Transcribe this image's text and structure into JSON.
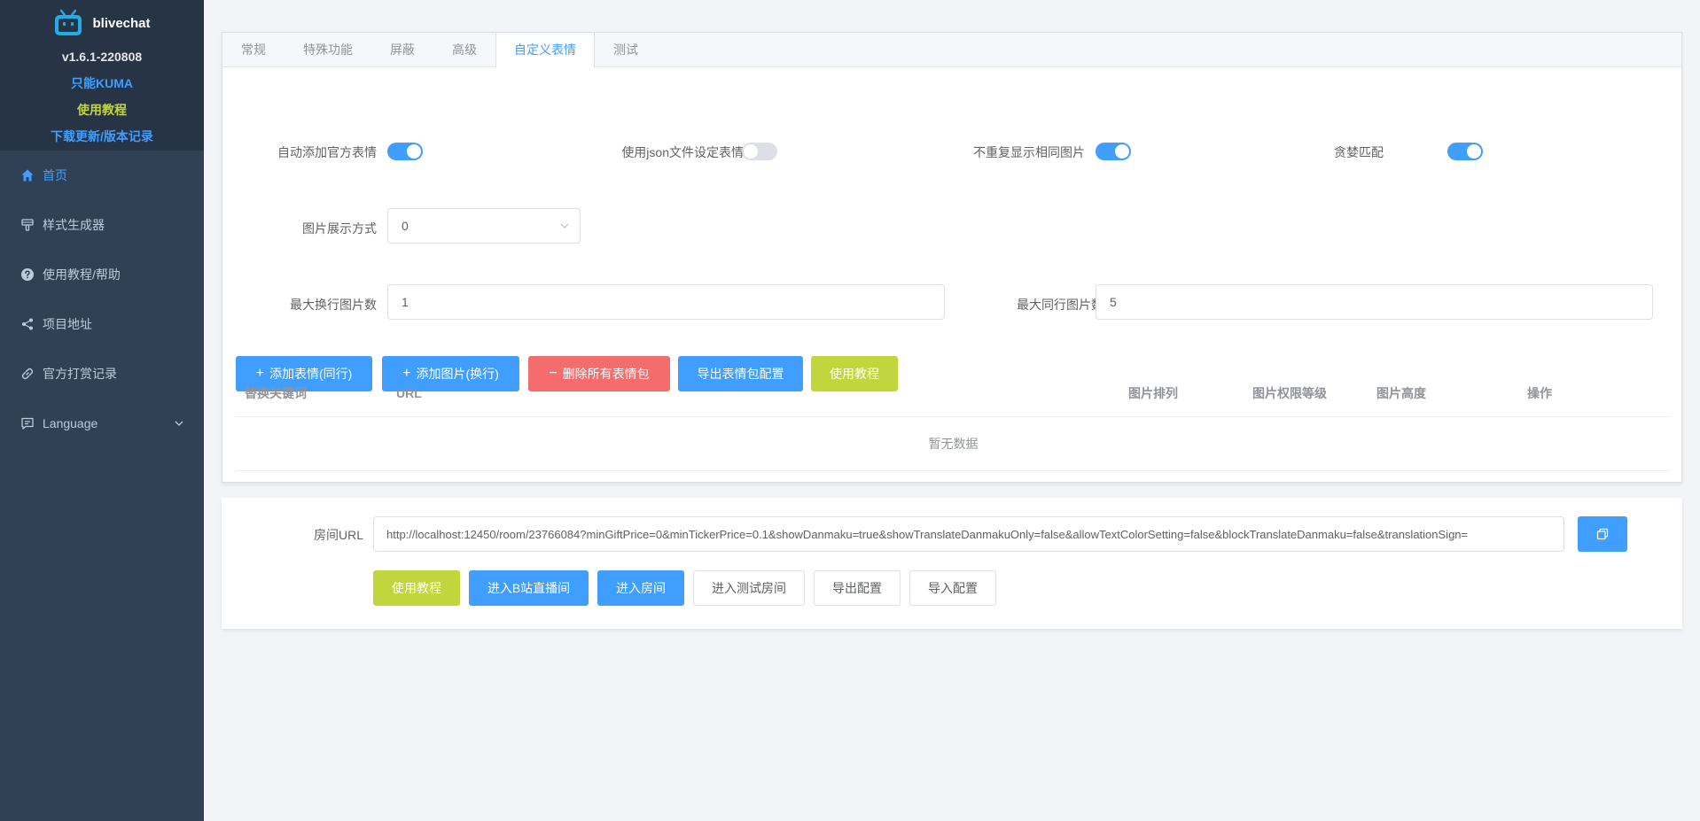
{
  "brand": {
    "name": "blivechat",
    "version": "v1.6.1-220808",
    "links": [
      {
        "label": "只能KUMA",
        "color": "#409eff"
      },
      {
        "label": "使用教程",
        "color": "#c0d63c"
      },
      {
        "label": "下载更新/版本记录",
        "color": "#409eff"
      }
    ]
  },
  "sidebar": {
    "items": [
      {
        "label": "首页",
        "icon": "home-icon",
        "active": true
      },
      {
        "label": "样式生成器",
        "icon": "brush-icon"
      },
      {
        "label": "使用教程/帮助",
        "icon": "question-icon"
      },
      {
        "label": "项目地址",
        "icon": "share-icon"
      },
      {
        "label": "官方打赏记录",
        "icon": "link-icon"
      },
      {
        "label": "Language",
        "icon": "chat-icon",
        "has_submenu": true
      }
    ]
  },
  "tabs": [
    "常规",
    "特殊功能",
    "屏蔽",
    "高级",
    "自定义表情",
    "测试"
  ],
  "active_tab": 4,
  "form": {
    "auto_add_official_emoticon": {
      "label": "自动添加官方表情",
      "on": true
    },
    "use_json_file": {
      "label": "使用json文件设定表情",
      "on": false
    },
    "no_repeat_image": {
      "label": "不重复显示相同图片",
      "on": true
    },
    "greedy_match": {
      "label": "贪婪匹配",
      "on": true
    },
    "image_display_mode": {
      "label": "图片展示方式",
      "value": "0"
    },
    "max_wrap_images": {
      "label": "最大换行图片数",
      "value": "1"
    },
    "max_inline_images": {
      "label": "最大同行图片数",
      "value": "5"
    }
  },
  "actions": {
    "add_emoticon_inline": "添加表情(同行)",
    "add_image_wrap": "添加图片(换行)",
    "delete_all": "删除所有表情包",
    "export_config": "导出表情包配置",
    "tutorial": "使用教程"
  },
  "table": {
    "columns": [
      "替换关键词",
      "URL",
      "图片排列",
      "图片权限等级",
      "图片高度",
      "操作"
    ],
    "empty_text": "暂无数据"
  },
  "room": {
    "label": "房间URL",
    "url": "http://localhost:12450/room/23766084?minGiftPrice=0&minTickerPrice=0.1&showDanmaku=true&showTranslateDanmakuOnly=false&allowTextColorSetting=false&blockTranslateDanmaku=false&translationSign=",
    "buttons": {
      "tutorial": "使用教程",
      "enter_bili_room": "进入B站直播间",
      "enter_room": "进入房间",
      "enter_test_room": "进入测试房间",
      "export_config": "导出配置",
      "import_config": "导入配置"
    }
  },
  "colors": {
    "primary": "#409eff",
    "danger": "#f56c6c",
    "lime": "#c0d63c",
    "sidebar_bg": "#304156"
  }
}
